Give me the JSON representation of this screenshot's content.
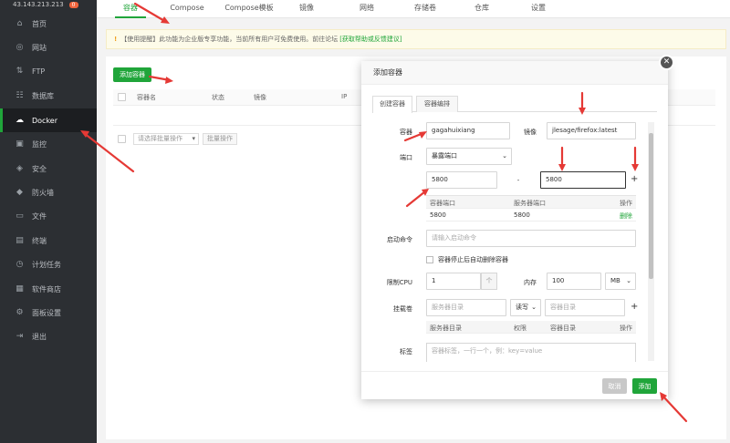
{
  "sidebar": {
    "top_text": "43.143.213.213",
    "top_badge": "0",
    "items": [
      {
        "label": "首页",
        "icon": "home-icon",
        "glyph": "⌂"
      },
      {
        "label": "网站",
        "icon": "globe-icon",
        "glyph": "◎"
      },
      {
        "label": "FTP",
        "icon": "ftp-icon",
        "glyph": "⇅"
      },
      {
        "label": "数据库",
        "icon": "database-icon",
        "glyph": "☷"
      },
      {
        "label": "Docker",
        "icon": "docker-icon",
        "glyph": "☁"
      },
      {
        "label": "监控",
        "icon": "monitor-icon",
        "glyph": "▣"
      },
      {
        "label": "安全",
        "icon": "shield-icon",
        "glyph": "◈"
      },
      {
        "label": "防火墙",
        "icon": "firewall-icon",
        "glyph": "◆"
      },
      {
        "label": "文件",
        "icon": "folder-icon",
        "glyph": "▭"
      },
      {
        "label": "终端",
        "icon": "terminal-icon",
        "glyph": "▤"
      },
      {
        "label": "计划任务",
        "icon": "clock-icon",
        "glyph": "◷"
      },
      {
        "label": "软件商店",
        "icon": "grid-icon",
        "glyph": "▦"
      },
      {
        "label": "面板设置",
        "icon": "gear-icon",
        "glyph": "⚙"
      },
      {
        "label": "退出",
        "icon": "logout-icon",
        "glyph": "⇥"
      }
    ],
    "active_index": 4
  },
  "tabs": [
    "容器",
    "Compose",
    "Compose模板",
    "镜像",
    "网络",
    "存储卷",
    "仓库",
    "设置"
  ],
  "notice": {
    "text": "【使用提醒】此功能为企业版专享功能，当前所有用户可免费使用。前往论坛",
    "link": "[获取帮助或反馈建议]"
  },
  "toolbar": {
    "add_container": "添加容器"
  },
  "list": {
    "columns": [
      "容器名",
      "状态",
      "镜像",
      "IP"
    ],
    "batch_placeholder": "请选择批量操作",
    "batch_button": "批量操作"
  },
  "modal": {
    "title": "添加容器",
    "close": "✕",
    "tabs": [
      "创建容器",
      "容器编排"
    ],
    "container_label": "容器",
    "container_value": "gagahuixiang",
    "image_label": "镜像",
    "image_value": "jlesage/firefox:latest",
    "port_label": "端口",
    "port_mode": "暴露端口",
    "container_port": "5800",
    "port_dash": "-",
    "host_port": "5800",
    "add_port": "+",
    "port_table": {
      "headers": [
        "容器端口",
        "服务器端口",
        "操作"
      ],
      "rows": [
        {
          "container": "5800",
          "server": "5800",
          "action": "删除"
        }
      ]
    },
    "start_cmd_label": "启动命令",
    "start_cmd_placeholder": "请输入启动命令",
    "auto_remove": "容器停止后自动删除容器",
    "cpu_label": "限制CPU",
    "cpu_value": "1",
    "cpu_step": "个",
    "mem_label": "内存",
    "mem_value": "100",
    "mem_unit": "MB",
    "volume_label": "挂载卷",
    "volume_server_ph": "服务器目录",
    "volume_mode": "读写",
    "volume_container_ph": "容器目录",
    "add_volume": "+",
    "volume_headers": [
      "服务器目录",
      "权限",
      "容器目录",
      "操作"
    ],
    "labels_label": "标签",
    "labels_placeholder": "容器标签，一行一个，例：key=value",
    "cancel": "取消",
    "submit": "添加"
  },
  "colors": {
    "accent": "#20a53a",
    "sidebar": "#2c2f33",
    "annotation": "#e53935"
  }
}
